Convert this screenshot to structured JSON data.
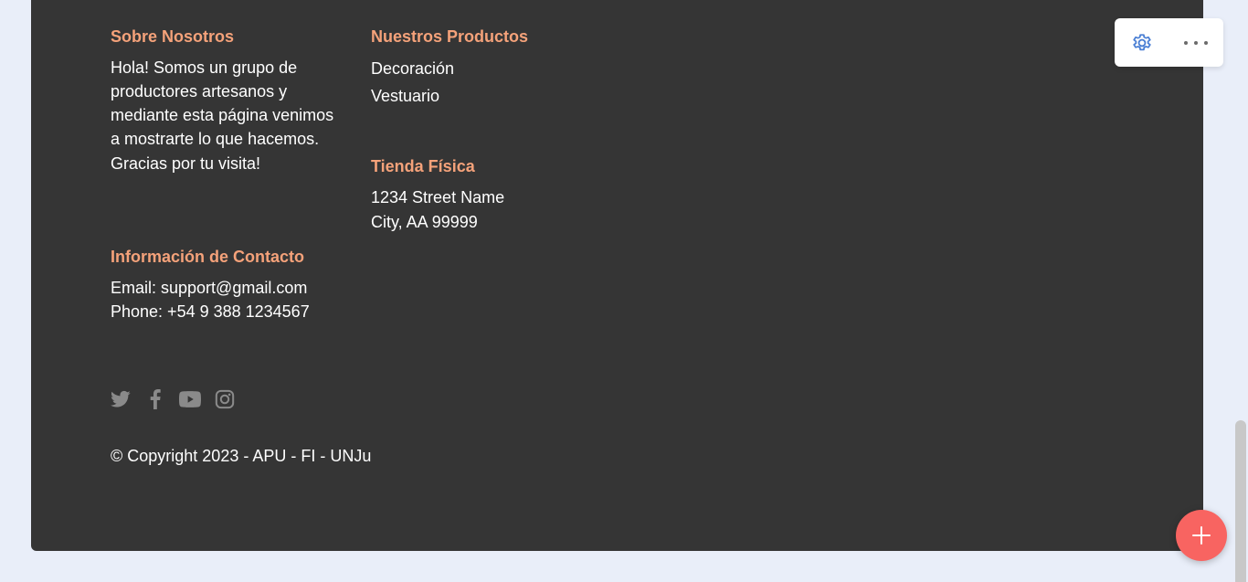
{
  "about": {
    "heading": "Sobre Nosotros",
    "lines": [
      "Hola! Somos un grupo de",
      "productores artesanos y",
      "mediante esta página venimos",
      "a mostrarte lo que hacemos.",
      "Gracias por tu visita!"
    ]
  },
  "products": {
    "heading": "Nuestros Productos",
    "items": [
      "Decoración",
      "Vestuario"
    ]
  },
  "store": {
    "heading": "Tienda Física",
    "lines": [
      "1234 Street Name",
      "City, AA 99999"
    ]
  },
  "contact": {
    "heading": "Información de Contacto",
    "email": "Email: support@gmail.com",
    "phone": "Phone: +54 9 388 1234567"
  },
  "social": {
    "icons": [
      "twitter-icon",
      "facebook-icon",
      "youtube-icon",
      "instagram-icon"
    ],
    "color": "#8a8a8a"
  },
  "copyright": "© Copyright 2023 - APU - FI - UNJu",
  "toolbar": {
    "icons": [
      "gear-icon",
      "more-horizontal-icon"
    ],
    "accent": "#4a7fd4"
  },
  "fab": {
    "icon": "plus-icon",
    "color": "#f86461"
  },
  "colors": {
    "footer_bg": "#353535",
    "heading": "#f5a27a",
    "page_bg": "#e9eef9"
  }
}
